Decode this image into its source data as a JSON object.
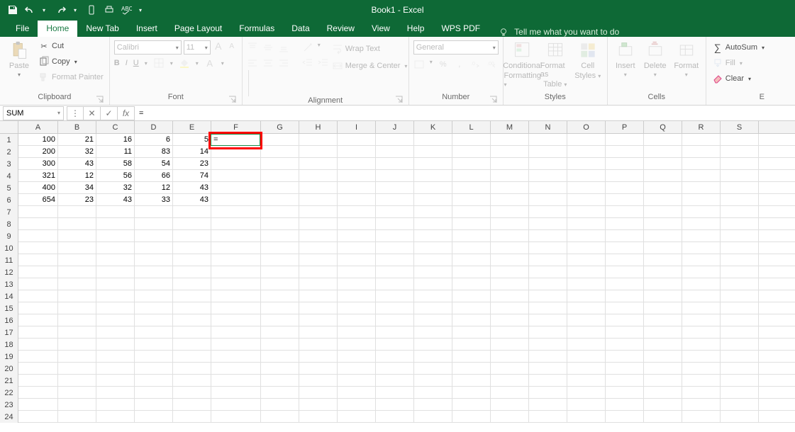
{
  "title": "Book1 - Excel",
  "qat": {
    "tooltips": [
      "save",
      "undo",
      "redo",
      "touch",
      "spell",
      "customize"
    ]
  },
  "tabs": [
    "File",
    "Home",
    "New Tab",
    "Insert",
    "Page Layout",
    "Formulas",
    "Data",
    "Review",
    "View",
    "Help",
    "WPS PDF"
  ],
  "active_tab": "Home",
  "tellme": "Tell me what you want to do",
  "ribbon": {
    "clipboard": {
      "label": "Clipboard",
      "paste": "Paste",
      "cut": "Cut",
      "copy": "Copy",
      "fmt": "Format Painter"
    },
    "font": {
      "label": "Font",
      "name": "Calibri",
      "size": "11",
      "bold": "B",
      "italic": "I",
      "under": "U",
      "incA": "A",
      "decA": "A"
    },
    "alignment": {
      "label": "Alignment",
      "wrap": "Wrap Text",
      "merge": "Merge & Center"
    },
    "number": {
      "label": "Number",
      "style": "General",
      "pct": "%",
      "comma": ","
    },
    "styles": {
      "label": "Styles",
      "cond": "Conditional",
      "cond2": "Formatting",
      "fat": "Format as",
      "fat2": "Table",
      "cs": "Cell",
      "cs2": "Styles"
    },
    "cells": {
      "label": "Cells",
      "ins": "Insert",
      "del": "Delete",
      "fmt": "Format"
    },
    "editing": {
      "label": "E",
      "sum": "AutoSum",
      "fill": "Fill",
      "clear": "Clear"
    }
  },
  "name_box": "SUM",
  "formula": "=",
  "columns": [
    "A",
    "B",
    "C",
    "D",
    "E",
    "F",
    "G",
    "H",
    "I",
    "J",
    "K",
    "L",
    "M",
    "N",
    "O",
    "P",
    "Q",
    "R",
    "S"
  ],
  "row_count": 24,
  "cells": {
    "A1": "100",
    "B1": "21",
    "C1": "16",
    "D1": "6",
    "E1": "5",
    "F1": "=",
    "A2": "200",
    "B2": "32",
    "C2": "11",
    "D2": "83",
    "E2": "14",
    "A3": "300",
    "B3": "43",
    "C3": "58",
    "D3": "54",
    "E3": "23",
    "A4": "321",
    "B4": "12",
    "C4": "56",
    "D4": "66",
    "E4": "74",
    "A5": "400",
    "B5": "34",
    "C5": "32",
    "D5": "12",
    "E5": "43",
    "A6": "654",
    "B6": "23",
    "C6": "43",
    "D6": "33",
    "E6": "43"
  },
  "active_cell": "F1"
}
